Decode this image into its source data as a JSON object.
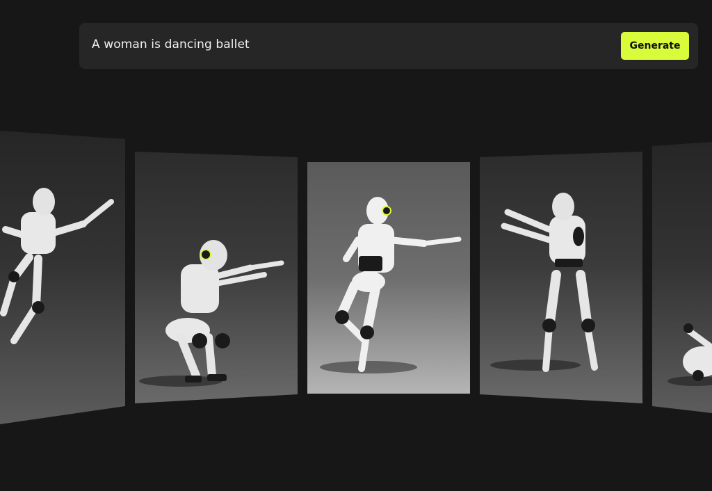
{
  "prompt": {
    "text": "A woman is dancing ballet",
    "generate_label": "Generate"
  },
  "colors": {
    "background": "#171717",
    "input_background": "#262626",
    "accent": "#d8fb3a",
    "robot_body": "#e8e8e8",
    "robot_joint": "#1a1a1a"
  },
  "gallery": {
    "panels": [
      {
        "pose": "leaping-arms-outstretched",
        "selected": false
      },
      {
        "pose": "deep-squat-arms-forward",
        "selected": false
      },
      {
        "pose": "standing-on-one-leg-arm-extended",
        "selected": true
      },
      {
        "pose": "standing-crossed-arms-forward",
        "selected": false
      },
      {
        "pose": "crouching-partially-visible",
        "selected": false
      }
    ]
  }
}
